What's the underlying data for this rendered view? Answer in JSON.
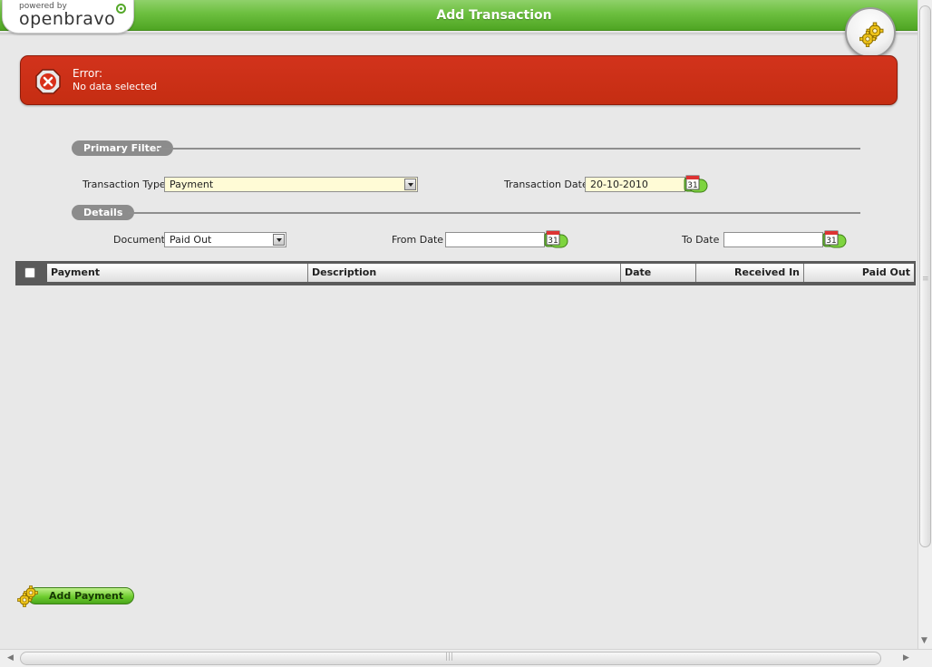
{
  "header": {
    "logo_small": "powered by",
    "logo_brand": "openbravo",
    "title": "Add Transaction",
    "process_icon": "gears-icon"
  },
  "error": {
    "icon": "error-x-icon",
    "title": "Error:",
    "message": "No data selected"
  },
  "primary_filter": {
    "label": "Primary Filter",
    "transaction_type_label": "Transaction Type",
    "transaction_type_value": "Payment",
    "transaction_date_label": "Transaction Date",
    "transaction_date_value": "20-10-2010"
  },
  "details": {
    "label": "Details",
    "document_label": "Document",
    "document_value": "Paid Out",
    "from_date_label": "From Date",
    "from_date_value": "",
    "to_date_label": "To Date",
    "to_date_value": ""
  },
  "grid": {
    "columns": [
      "Payment",
      "Description",
      "Date",
      "Received In",
      "Paid Out"
    ]
  },
  "actions": {
    "add_payment_label": "Add Payment"
  },
  "calendar_label": "31",
  "colors": {
    "header_green": "#6cbf3f",
    "error_red": "#c52d12",
    "required_yellow": "#fffbd6",
    "section_gray": "#8c8c8c"
  }
}
